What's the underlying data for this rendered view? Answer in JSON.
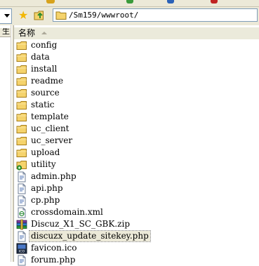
{
  "address_bar": {
    "path": "/Sm159/wwwroot/"
  },
  "left_pane": {
    "header_fragment": "生"
  },
  "list_header": {
    "name_column": "名称"
  },
  "files": [
    {
      "name": "config",
      "type": "folder"
    },
    {
      "name": "data",
      "type": "folder"
    },
    {
      "name": "install",
      "type": "folder"
    },
    {
      "name": "readme",
      "type": "folder"
    },
    {
      "name": "source",
      "type": "folder"
    },
    {
      "name": "static",
      "type": "folder"
    },
    {
      "name": "template",
      "type": "folder"
    },
    {
      "name": "uc_client",
      "type": "folder"
    },
    {
      "name": "uc_server",
      "type": "folder"
    },
    {
      "name": "upload",
      "type": "folder"
    },
    {
      "name": "utility",
      "type": "folder-special"
    },
    {
      "name": "admin.php",
      "type": "php"
    },
    {
      "name": "api.php",
      "type": "php"
    },
    {
      "name": "cp.php",
      "type": "php"
    },
    {
      "name": "crossdomain.xml",
      "type": "xml"
    },
    {
      "name": "Discuz_X1_SC_GBK.zip",
      "type": "zip"
    },
    {
      "name": "discuzx_update_sitekey.php",
      "type": "php",
      "selected": true
    },
    {
      "name": "favicon.ico",
      "type": "ico"
    },
    {
      "name": "forum.php",
      "type": "php"
    }
  ],
  "colors": {
    "chrome": "#ece9d8",
    "folder": "#f5d36c",
    "address_border": "#7f9db9"
  }
}
